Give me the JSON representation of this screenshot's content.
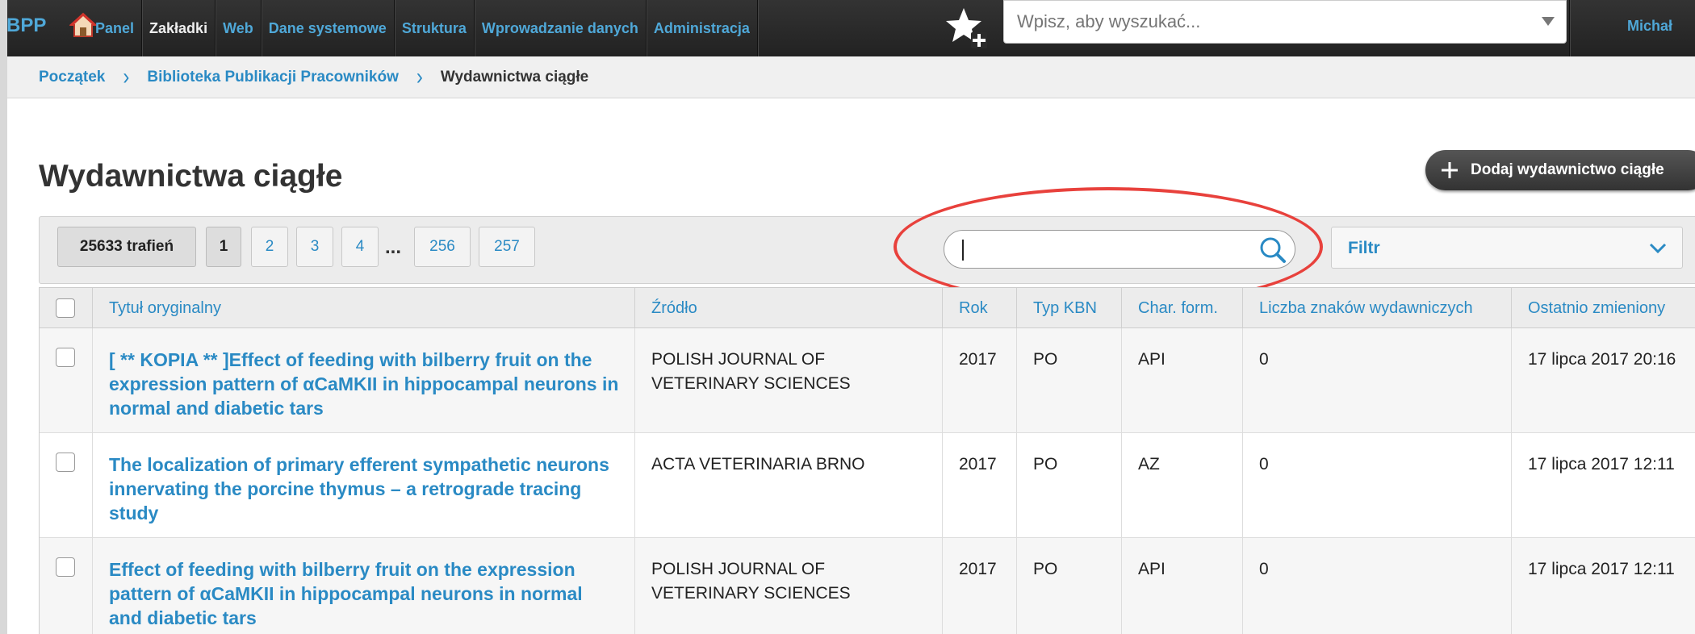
{
  "brand": "BPP",
  "nav": [
    "Panel",
    "Zakładki",
    "Web",
    "Dane systemowe",
    "Struktura",
    "Wprowadzanie danych",
    "Administracja"
  ],
  "nav_active": "Zakładki",
  "top_search": {
    "placeholder": "Wpisz, aby wyszukać..."
  },
  "user": "Michał",
  "breadcrumb": [
    "Początek",
    "Biblioteka Publikacji Pracowników",
    "Wydawnictwa ciągłe"
  ],
  "page_title": "Wydawnictwa ciągłe",
  "add_button": "Dodaj wydawnictwo ciągłe",
  "hits": "25633 trafień",
  "pagination": {
    "pages": [
      "1",
      "2",
      "3",
      "4"
    ],
    "ellipsis": "...",
    "last": [
      "256",
      "257"
    ],
    "current": "1"
  },
  "filter_label": "Filtr",
  "table": {
    "columns": [
      "Tytuł oryginalny",
      "Źródło",
      "Rok",
      "Typ KBN",
      "Char. form.",
      "Liczba znaków wydawniczych",
      "Ostatnio zmieniony"
    ],
    "rows": [
      {
        "title": "[ ** KOPIA ** ]Effect of feeding with bilberry fruit on the expression pattern of αCaMKII in hippocampal neurons in normal and diabetic tars",
        "source": "POLISH JOURNAL OF VETERINARY SCIENCES",
        "year": "2017",
        "kbn": "PO",
        "form": "API",
        "chars": "0",
        "modified": "17 lipca 2017 20:16"
      },
      {
        "title": "The localization of primary efferent sympathetic neurons innervating the porcine thymus – a retrograde tracing study",
        "source": "ACTA VETERINARIA BRNO",
        "year": "2017",
        "kbn": "PO",
        "form": "AZ",
        "chars": "0",
        "modified": "17 lipca 2017 12:11"
      },
      {
        "title": "Effect of feeding with bilberry fruit on the expression pattern of αCaMKII in hippocampal neurons in normal and diabetic tars",
        "source": "POLISH JOURNAL OF VETERINARY SCIENCES",
        "year": "2017",
        "kbn": "PO",
        "form": "API",
        "chars": "0",
        "modified": "17 lipca 2017 12:11"
      }
    ]
  },
  "colors": {
    "link": "#2a8ac4",
    "nav_link": "#4fa8d8",
    "annotation": "#e8413c",
    "topbar": "#2b2b2b"
  },
  "icons": [
    "home-icon",
    "star-add-icon",
    "dropdown-caret-icon",
    "plus-icon",
    "search-icon",
    "chevron-down-icon"
  ]
}
